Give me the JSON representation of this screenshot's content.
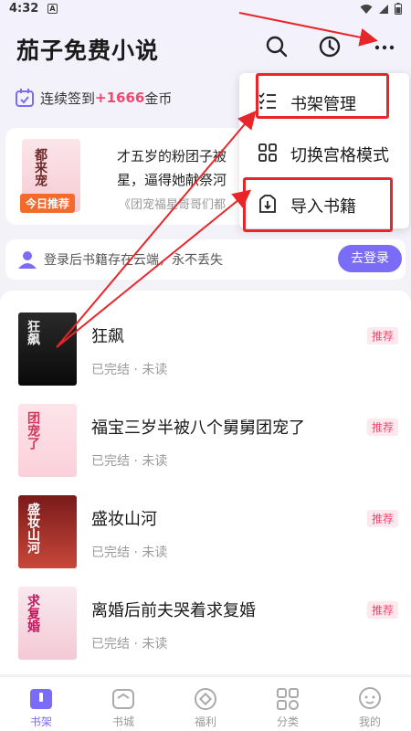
{
  "status": {
    "time": "4:32",
    "app_badge": "A"
  },
  "header": {
    "title": "茄子免费小说"
  },
  "checkin": {
    "prefix": "连续签到",
    "amount": "+1666",
    "suffix": "金币"
  },
  "recommend": {
    "badge": "今日推荐",
    "line1": "才五岁的粉团子被",
    "line2": "星，逼得她献祭河",
    "source": "《团宠福星哥哥们都",
    "cover_text": "都来宠"
  },
  "login": {
    "text": "登录后书籍存在云端，永不丢失",
    "button": "去登录"
  },
  "menu": {
    "items": [
      {
        "label": "书架管理",
        "icon": "list-icon"
      },
      {
        "label": "切换宫格模式",
        "icon": "grid-icon"
      },
      {
        "label": "导入书籍",
        "icon": "import-icon"
      }
    ]
  },
  "books": [
    {
      "title": "狂飙",
      "meta": "已完结 · 未读",
      "tag": "推荐",
      "cover_text": "狂飙"
    },
    {
      "title": "福宝三岁半被八个舅舅团宠了",
      "meta": "已完结 · 未读",
      "tag": "推荐",
      "cover_text": "团宠了"
    },
    {
      "title": "盛妆山河",
      "meta": "已完结 · 未读",
      "tag": "推荐",
      "cover_text": "盛妆山河"
    },
    {
      "title": "离婚后前夫哭着求复婚",
      "meta": "已完结 · 未读",
      "tag": "推荐",
      "cover_text": "求复婚"
    }
  ],
  "tabs": [
    {
      "label": "书架",
      "icon": "bookshelf-icon"
    },
    {
      "label": "书城",
      "icon": "bookstore-icon"
    },
    {
      "label": "福利",
      "icon": "welfare-icon"
    },
    {
      "label": "分类",
      "icon": "category-icon"
    },
    {
      "label": "我的",
      "icon": "profile-icon"
    }
  ],
  "colors": {
    "accent": "#7b6cf6",
    "highlight": "#f2476f",
    "annotation": "#e8262a",
    "badge": "#f36a2a"
  }
}
